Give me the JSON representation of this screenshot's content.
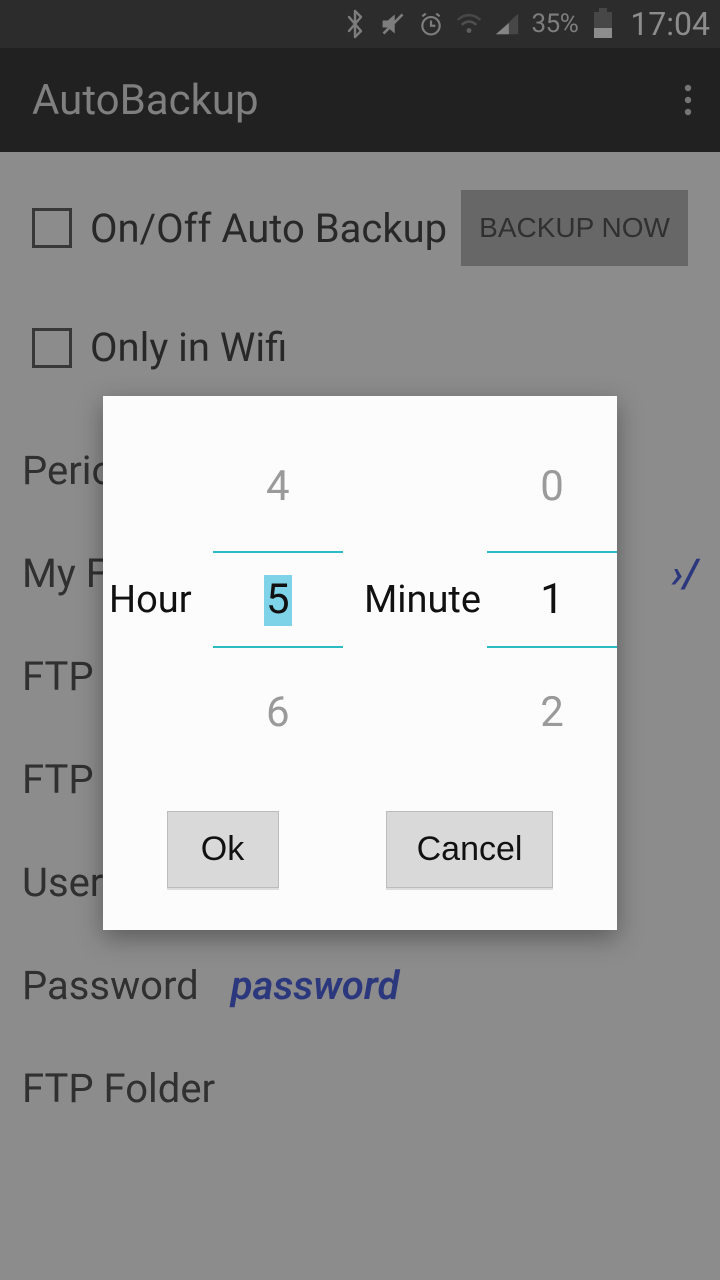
{
  "status": {
    "battery_pct": "35%",
    "time": "17:04"
  },
  "appbar": {
    "title": "AutoBackup"
  },
  "options": {
    "auto_backup_label": "On/Off Auto Backup",
    "backup_now": "BACKUP NOW",
    "only_wifi_label": "Only in Wifi"
  },
  "form": {
    "period_label": "Period",
    "myf_label": "My F",
    "myf_value_tail": "›/",
    "ftp_a_label": "FTP A",
    "ftp_label": "FTP",
    "user_label": "User",
    "password_label": "Password",
    "password_value": "password",
    "ftp_folder_label": "FTP Folder"
  },
  "dialog": {
    "hour_label": "Hour",
    "minute_label": "Minute",
    "hour_prev": "4",
    "hour_current": "5",
    "hour_next": "6",
    "minute_prev": "0",
    "minute_current": "1",
    "minute_next": "2",
    "ok": "Ok",
    "cancel": "Cancel"
  }
}
